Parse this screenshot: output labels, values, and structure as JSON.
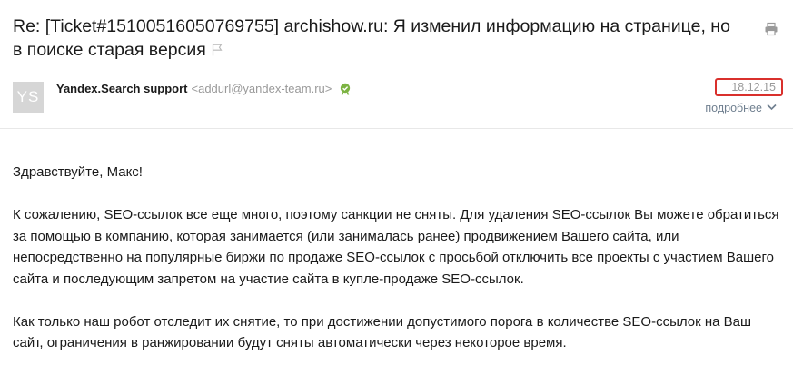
{
  "subject": "Re: [Ticket#15100516050769755] archishow.ru: Я изменил информацию на странице, но в поиске старая версия",
  "sender": {
    "avatar_initials": "YS",
    "name": "Yandex.Search support",
    "email": "<addurl@yandex-team.ru>"
  },
  "date": "18.12.15",
  "details_label": "подробнее",
  "body": {
    "greeting": "Здравствуйте, Макс!",
    "paragraph1": "К сожалению, SEO-ссылок все еще много, поэтому санкции не сняты. Для удаления SEO-ссылок Вы можете обратиться за помощью в компанию, которая занимается (или занималась ранее) продвижением Вашего сайта, или непосредственно на популярные биржи по продаже SEO-ссылок с просьбой отключить все проекты с участием Вашего сайта и последующим запретом на участие сайта в купле-продаже SEO-ссылок.",
    "paragraph2": "Как только наш робот отследит их снятие, то при достижении допустимого порога в количестве SEO-ссылок на Ваш сайт, ограничения в ранжировании будут сняты автоматически через некоторое время."
  },
  "colors": {
    "date_highlight_border": "#d9302c",
    "verified_badge": "#7cb342",
    "details_link": "#6f7f8f"
  },
  "icons": [
    "flag-icon",
    "print-icon",
    "verified-icon",
    "chevron-down-icon"
  ]
}
